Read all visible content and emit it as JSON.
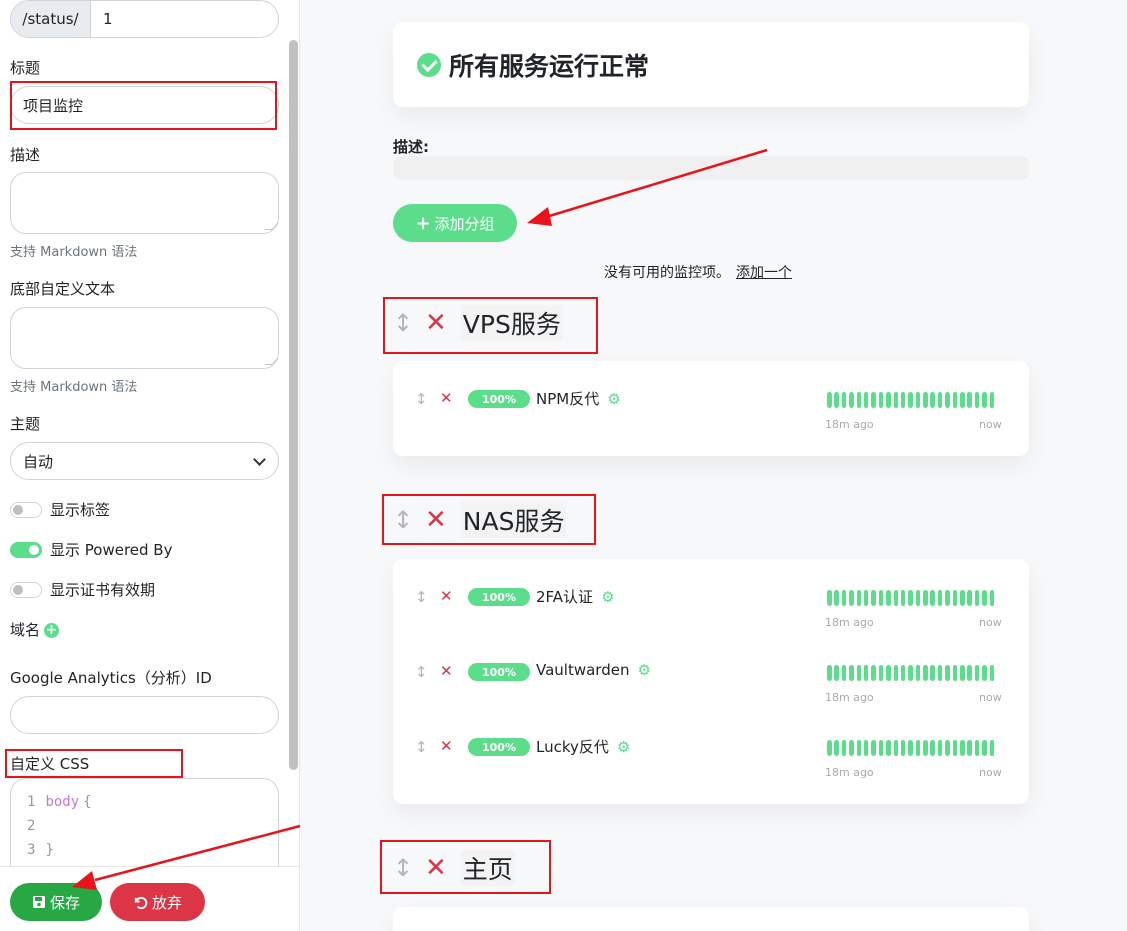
{
  "sidebar": {
    "slug_prefix": "/status/",
    "slug_value": "1",
    "title_label": "标题",
    "title_value": "项目监控",
    "description_label": "描述",
    "markdown_hint": "支持 Markdown 语法",
    "footer_text_label": "底部自定义文本",
    "markdown_hint_2": "支持 Markdown 语法",
    "theme_label": "主题",
    "theme_value": "自动",
    "toggles": [
      {
        "label": "显示标签",
        "on": false
      },
      {
        "label": "显示 Powered By",
        "on": true
      },
      {
        "label": "显示证书有效期",
        "on": false
      }
    ],
    "domain_label": "域名",
    "ga_label": "Google Analytics（分析）ID",
    "ga_value": "",
    "css_label": "自定义 CSS",
    "css_lines": [
      {
        "num": "1",
        "text": "body",
        "brace": "{"
      },
      {
        "num": "2",
        "text": "",
        "brace": ""
      },
      {
        "num": "3",
        "text": "",
        "brace": "}"
      }
    ],
    "save_label": "保存",
    "discard_label": "放弃"
  },
  "main": {
    "status_text": "所有服务运行正常",
    "description_label": "描述:",
    "add_group_label": "添加分组",
    "empty_text": "没有可用的监控项。",
    "add_one_link": "添加一个",
    "groups": [
      {
        "name": "VPS服务",
        "monitors": [
          {
            "percent": "100%",
            "name": "NPM反代",
            "time_start": "18m ago",
            "time_end": "now"
          }
        ]
      },
      {
        "name": "NAS服务",
        "monitors": [
          {
            "percent": "100%",
            "name": "2FA认证",
            "time_start": "18m ago",
            "time_end": "now"
          },
          {
            "percent": "100%",
            "name": "Vaultwarden",
            "time_start": "18m ago",
            "time_end": "now"
          },
          {
            "percent": "100%",
            "name": "Lucky反代",
            "time_start": "18m ago",
            "time_end": "now"
          }
        ]
      },
      {
        "name": "主页",
        "monitors": []
      }
    ]
  },
  "icons": {
    "drag": "↕",
    "delete": "✕",
    "gear": "⚙",
    "check": "check-circle",
    "plus": "+",
    "save": "floppy",
    "discard": "undo"
  },
  "colors": {
    "accent_green": "#5cdd8b",
    "save_green": "#28a745",
    "danger_red": "#dc3545",
    "annotation_red": "#e8141c"
  }
}
